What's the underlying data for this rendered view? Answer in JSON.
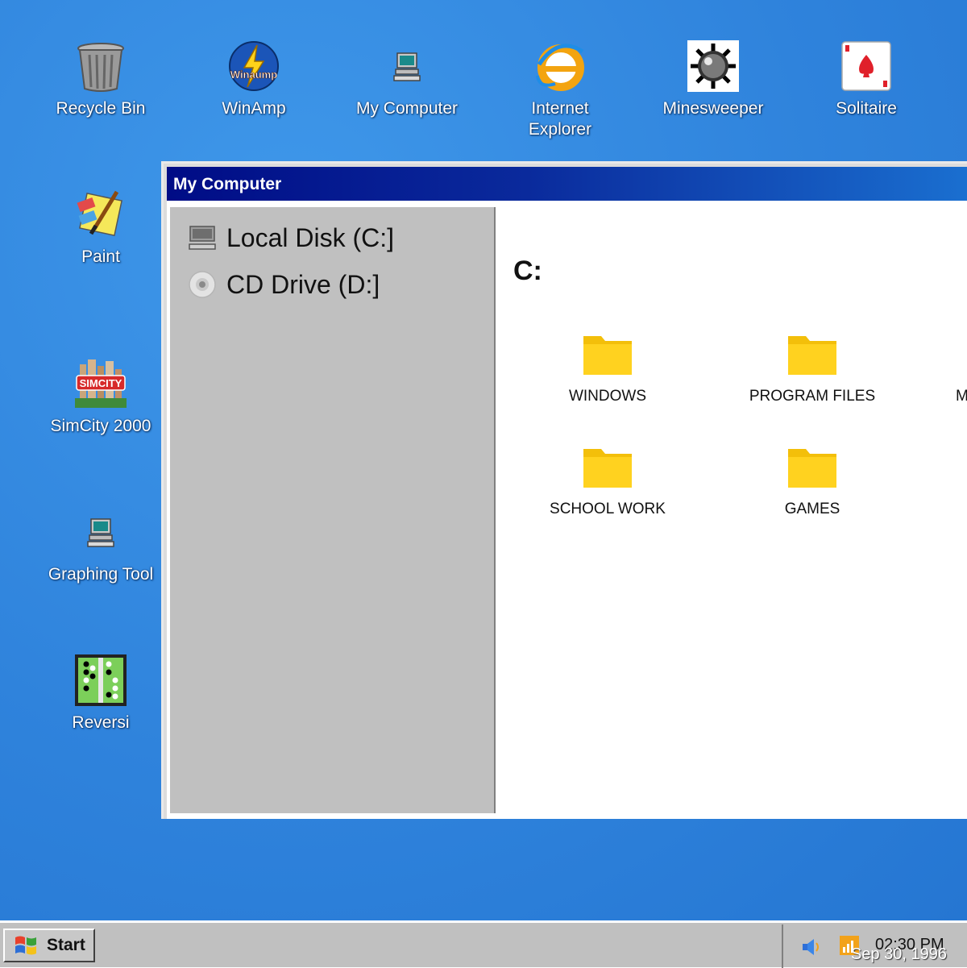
{
  "desktop": {
    "icons": [
      {
        "label": "Recycle Bin",
        "icon": "recycle-bin-icon"
      },
      {
        "label": "WinAmp",
        "icon": "winamp-icon",
        "badge_text": "Winaump"
      },
      {
        "label": "My Computer",
        "icon": "computer-icon"
      },
      {
        "label": "Internet Explorer",
        "icon": "internet-explorer-icon"
      },
      {
        "label": "Minesweeper",
        "icon": "mine-icon"
      },
      {
        "label": "Solitaire",
        "icon": "playing-card-icon"
      },
      {
        "label": "Paint",
        "icon": "paint-icon"
      },
      {
        "label": "SimCity 2000",
        "icon": "simcity-icon",
        "badge_text": "SIMCITY"
      },
      {
        "label": "Graphing Tool",
        "icon": "computer-icon"
      },
      {
        "label": "Reversi",
        "icon": "reversi-board-icon"
      }
    ]
  },
  "window": {
    "title": "My Computer",
    "sidebar": {
      "drives": [
        {
          "label": "Local Disk (C:]",
          "icon": "hard-disk-icon"
        },
        {
          "label": "CD Drive (D:]",
          "icon": "cd-icon"
        }
      ]
    },
    "content": {
      "path": "C:",
      "folders": [
        {
          "label": "WINDOWS",
          "icon": "folder-icon"
        },
        {
          "label": "PROGRAM FILES",
          "icon": "folder-icon"
        },
        {
          "label": "M",
          "icon": "folder-icon"
        },
        {
          "label": "SCHOOL WORK",
          "icon": "folder-icon"
        },
        {
          "label": "GAMES",
          "icon": "folder-icon"
        }
      ]
    }
  },
  "taskbar": {
    "start_label": "Start",
    "tray": {
      "time": "02:30 PM",
      "date": "Sep 30, 1996",
      "icons": [
        "speaker-icon",
        "network-signal-icon"
      ]
    }
  },
  "colors": {
    "desktop": "#2f83dc",
    "titlebar": "#000c86",
    "folder": "#ffd21f",
    "taskbar": "#c0c0c0"
  }
}
